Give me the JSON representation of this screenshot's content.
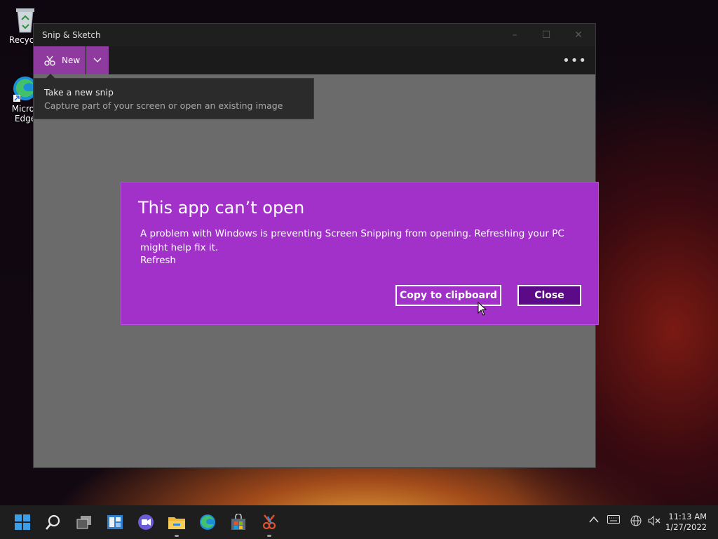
{
  "desktop": {
    "icons": [
      {
        "label": "Recycle"
      },
      {
        "label": "Micros Edge"
      }
    ]
  },
  "window": {
    "title": "Snip & Sketch",
    "toolbar": {
      "new_label": "New"
    },
    "tooltip": {
      "title": "Take a new snip",
      "subtitle": "Capture part of your screen or open an existing image"
    }
  },
  "dialog": {
    "heading": "This app can’t open",
    "message": "A problem with Windows is preventing Screen Snipping from opening. Refreshing your PC might help fix it.",
    "link": "Refresh",
    "copy_button": "Copy to clipboard",
    "close_button": "Close"
  },
  "taskbar": {
    "time": "11:13 AM",
    "date": "1/27/2022"
  },
  "colors": {
    "dialog_bg": "#a131c9",
    "close_btn_bg": "#5c0a87",
    "accent": "#8e3a9e"
  }
}
